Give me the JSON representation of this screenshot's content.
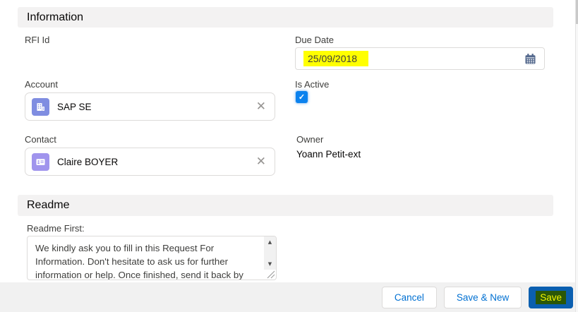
{
  "glyphs": {
    "close": "✕",
    "check": "✓",
    "arrow_up": "▲",
    "arrow_down": "▼"
  },
  "colors": {
    "section_header_bg": "#f3f2f2",
    "highlight_yellow": "#ffff00",
    "accent_blue": "#0070d2",
    "checkbox_blue": "#0b82ee",
    "account_icon_bg": "#7f8de1",
    "contact_icon_bg": "#a094ed",
    "calendar_icon": "#54698d",
    "save_button_bg": "#0b5fb0",
    "save_highlight_bg": "#2a5708",
    "save_highlight_text": "#f3f500"
  },
  "icons": {
    "due_date": "calendar-icon",
    "account": "building-icon",
    "contact": "contact-card-icon"
  },
  "information_section": {
    "title": "Information",
    "rfi_id": {
      "label": "RFI Id"
    },
    "due_date": {
      "label": "Due Date",
      "value": "25/09/2018"
    },
    "account": {
      "label": "Account",
      "value": "SAP SE"
    },
    "is_active": {
      "label": "Is Active",
      "checked": true
    },
    "contact": {
      "label": "Contact",
      "value": "Claire BOYER"
    },
    "owner": {
      "label": "Owner",
      "value": "Yoann Petit-ext"
    }
  },
  "readme_section": {
    "title": "Readme",
    "readme_first": {
      "label": "Readme First:",
      "value": "We kindly ask you to fill in this Request For Information. Don't hesitate to ask us for further information or help. Once finished, send it back by"
    }
  },
  "footer": {
    "cancel_label": "Cancel",
    "save_and_new_label": "Save & New",
    "save_label": "Save"
  }
}
